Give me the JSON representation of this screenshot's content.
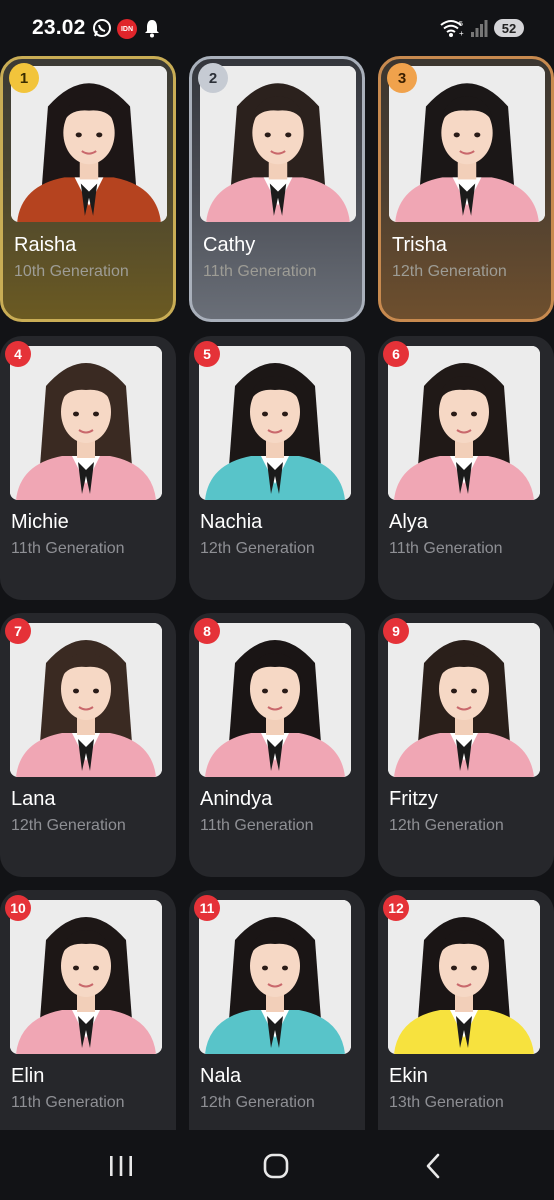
{
  "status_bar": {
    "time": "23.02",
    "idn_badge": "IDN",
    "battery": "52",
    "icons": [
      "whatsapp-icon",
      "idn-icon",
      "bell-icon",
      "wifi-icon",
      "signal-icon",
      "battery-icon"
    ]
  },
  "members": [
    {
      "rank": "1",
      "name": "Raisha",
      "generation": "10th Generation",
      "tier": "gold",
      "outfit": "#b5431f",
      "hair": "#1d1616"
    },
    {
      "rank": "2",
      "name": "Cathy",
      "generation": "11th Generation",
      "tier": "silver",
      "outfit": "#f0a6b4",
      "hair": "#2b211d"
    },
    {
      "rank": "3",
      "name": "Trisha",
      "generation": "12th Generation",
      "tier": "bronze",
      "outfit": "#f0a6b4",
      "hair": "#1b1717"
    },
    {
      "rank": "4",
      "name": "Michie",
      "generation": "11th Generation",
      "tier": "normal",
      "outfit": "#f0a6b4",
      "hair": "#3a2a22"
    },
    {
      "rank": "5",
      "name": "Nachia",
      "generation": "12th Generation",
      "tier": "normal",
      "outfit": "#58c4c9",
      "hair": "#1c1716"
    },
    {
      "rank": "6",
      "name": "Alya",
      "generation": "11th Generation",
      "tier": "normal",
      "outfit": "#f0a6b4",
      "hair": "#201917"
    },
    {
      "rank": "7",
      "name": "Lana",
      "generation": "12th Generation",
      "tier": "normal",
      "outfit": "#f0a6b4",
      "hair": "#3a2a22"
    },
    {
      "rank": "8",
      "name": "Anindya",
      "generation": "11th Generation",
      "tier": "normal",
      "outfit": "#f0a6b4",
      "hair": "#1a1515"
    },
    {
      "rank": "9",
      "name": "Fritzy",
      "generation": "12th Generation",
      "tier": "normal",
      "outfit": "#f0a6b4",
      "hair": "#2a1f1a"
    },
    {
      "rank": "10",
      "name": "Elin",
      "generation": "11th Generation",
      "tier": "normal",
      "outfit": "#f0a6b4",
      "hair": "#1d1716"
    },
    {
      "rank": "11",
      "name": "Nala",
      "generation": "12th Generation",
      "tier": "normal",
      "outfit": "#58c4c9",
      "hair": "#1a1515"
    },
    {
      "rank": "12",
      "name": "Ekin",
      "generation": "13th Generation",
      "tier": "normal",
      "outfit": "#f7e23e",
      "hair": "#1a1515"
    }
  ],
  "colors": {
    "background": "#121316",
    "card": "#26272b",
    "rank_badge": "#e53238",
    "gold": "#c9ad55",
    "silver": "#a9b0bb",
    "bronze": "#c88a4f"
  },
  "nav_bar": {
    "icons": [
      "recents-icon",
      "home-icon",
      "back-icon"
    ]
  }
}
